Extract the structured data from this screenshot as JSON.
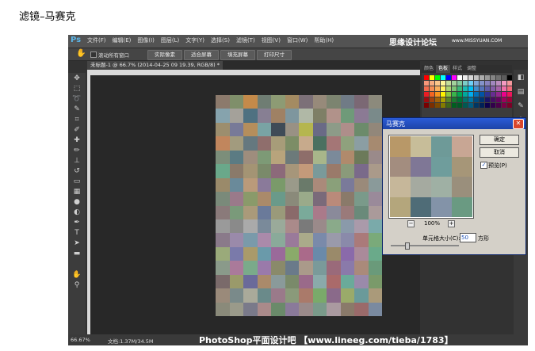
{
  "page_title": "滤镜–马赛克",
  "app": {
    "logo": "Ps",
    "menu": [
      "文件(F)",
      "编辑(E)",
      "图像(I)",
      "图层(L)",
      "文字(Y)",
      "选择(S)",
      "滤镜(T)",
      "视图(V)",
      "窗口(W)",
      "帮助(H)"
    ],
    "watermark_top": "思缘设计论坛",
    "watermark_top_url": "www.MISSYUAN.COM"
  },
  "options_bar": {
    "tool_icon": "hand-icon",
    "scroll_all_label": "滚动所有窗口",
    "buttons": [
      "实际像素",
      "适合屏幕",
      "填充屏幕",
      "打印尺寸"
    ]
  },
  "document": {
    "tab_label": "未标题-1 @ 66.7% (2014-04-25 09 19.39, RGB/8) *",
    "zoom": "66.67%",
    "doc_info": "文档:1.37M/34.5M"
  },
  "panel": {
    "tabs": [
      "颜色",
      "色板",
      "样式",
      "调整"
    ],
    "active_tab": "色板"
  },
  "dialog": {
    "title": "马赛克",
    "ok": "确定",
    "cancel": "取消",
    "preview_label": "预览(P)",
    "preview_checked": "✓",
    "zoom": "100%",
    "cell_size_label": "单元格大小(C):",
    "cell_size_value": "50",
    "cell_size_unit": "方形",
    "preview_cells": [
      "#b89868",
      "#c7bd99",
      "#6e9a98",
      "#c8a694",
      "#a38d7f",
      "#7f7796",
      "#6f9d9c",
      "#a69678",
      "#c6b79a",
      "#a5aaa0",
      "#9fb0a4",
      "#9a8f7c",
      "#b4a67c",
      "#4f6c77",
      "#8393a8",
      "#6a9a82"
    ]
  },
  "watermark_bottom": "PhotoShop平面设计吧 【www.lineeg.com/tieba/1783】",
  "mosaic_colors": [
    "#8c7a6c",
    "#7f8f6a",
    "#c48a4a",
    "#6f7d73",
    "#8d9b74",
    "#a48b62",
    "#7c7078",
    "#978a7a",
    "#7c8470",
    "#707b86",
    "#7b6874",
    "#8c8a7c",
    "#86a3ad",
    "#a4a19a",
    "#4f7181",
    "#877f93",
    "#9f8164",
    "#7e969e",
    "#b0b8a6",
    "#7e7f66",
    "#b1928a",
    "#6f9a79",
    "#8b7a94",
    "#7a8a8a",
    "#9c8e6e",
    "#787a98",
    "#b58e5c",
    "#79a3a4",
    "#3f4b57",
    "#999184",
    "#b5b64f",
    "#6a6a86",
    "#8d9b88",
    "#ae8e8a",
    "#6c8b6b",
    "#92877a",
    "#c1865d",
    "#a29b7e",
    "#65787f",
    "#8f6e6c",
    "#a79c79",
    "#7c8d66",
    "#c7aa8c",
    "#4b7060",
    "#a47676",
    "#8fa17d",
    "#8b9ea3",
    "#a68a70",
    "#7c8e7a",
    "#5b7b83",
    "#9e8d7d",
    "#7d9a76",
    "#b8a47c",
    "#6c7a7a",
    "#8e6e6a",
    "#a8b68a",
    "#7b8a9a",
    "#b08a6c",
    "#6c7a5a",
    "#9a8a8a",
    "#6aa88a",
    "#8a7a6a",
    "#a49474",
    "#7a8a6a",
    "#8c6a7a",
    "#a6967a",
    "#c49a7a",
    "#7a9a9a",
    "#9a7a6a",
    "#8a9a7a",
    "#7a6a8a",
    "#aa9a8a",
    "#9a8a6a",
    "#6a8a9a",
    "#ba9a7a",
    "#8a7a9a",
    "#7a9a6a",
    "#9a9a8a",
    "#6a7a6a",
    "#aa8a7a",
    "#8aa07a",
    "#7a7a9a",
    "#9a8a7a",
    "#8a9a9a",
    "#7a8a7a",
    "#9a7a8a",
    "#8a9a6a",
    "#aa8a6a",
    "#6a9a8a",
    "#8a8a7a",
    "#9aaa8a",
    "#7a6a7a",
    "#ba8a7a",
    "#8a7a6a",
    "#7a9a8a",
    "#9a8a9a",
    "#8a7a7a",
    "#7a9a7a",
    "#aa9a7a",
    "#6a7a9a",
    "#9a9a7a",
    "#8a6a6a",
    "#7aaa9a",
    "#aa7a8a",
    "#8a8a9a",
    "#9a7a7a",
    "#6a8a7a",
    "#aa9a9a",
    "#9a9a9a",
    "#8a8a8a",
    "#aaaaaa",
    "#7a8a9a",
    "#9aaa9a",
    "#aa8a8a",
    "#7a7a7a",
    "#9a8a8a",
    "#8aaa8a",
    "#8a9aaa",
    "#aa9aaa",
    "#7aaaaa",
    "#8a7a8a",
    "#9a8aaa",
    "#7a9aaa",
    "#aa8aaa",
    "#8aaa9a",
    "#9a7a9a",
    "#aaaa8a",
    "#7a8aaa",
    "#9a9aaa",
    "#8a8aaa",
    "#aa7a7a",
    "#7aaa7a",
    "#9aaa7a",
    "#7a7aaa",
    "#aa9a6a",
    "#6a9aaa",
    "#9a6a9a",
    "#8aaa6a",
    "#aa6a8a",
    "#6a8aaa",
    "#9a8a6a",
    "#8a6aaa",
    "#aa8a9a",
    "#6aaa8a",
    "#8a9a8a",
    "#aa7a9a",
    "#7aaa8a",
    "#9a7aaa",
    "#8a8a6a",
    "#6a7a8a",
    "#aa9a8a",
    "#7a9a9a",
    "#9a6a7a",
    "#8a7aaa",
    "#aa8a7a",
    "#6a9a7a",
    "#7a6a6a",
    "#9a9a6a",
    "#6a6a9a",
    "#aa8a6a",
    "#8a9a9a",
    "#7a8a6a",
    "#9a6a8a",
    "#8aaaaa",
    "#aa6a6a",
    "#6aaa9a",
    "#9a8aaa",
    "#7a9a6a",
    "#9a8a7a",
    "#7a8a8a",
    "#aaaa9a",
    "#6a8a8a",
    "#9a7a8a",
    "#8a9a7a",
    "#aa7a6a",
    "#7aaa6a",
    "#8a6a8a",
    "#9aaa6a",
    "#6a9a9a",
    "#aa9a7a",
    "#8a8a7a",
    "#9a9a8a",
    "#7a7a8a",
    "#aa8a8a",
    "#6a8a6a",
    "#8a7a9a",
    "#9a8a8a",
    "#7a9a8a",
    "#aa9aa0",
    "#8a7a6a",
    "#9a6a6a",
    "#7a8aa0"
  ],
  "swatch_colors": [
    "#ff0000",
    "#ffff00",
    "#00ff00",
    "#00ffff",
    "#0000ff",
    "#ff00ff",
    "#ffffff",
    "#ebebeb",
    "#d6d6d6",
    "#c2c2c2",
    "#adadad",
    "#999999",
    "#858585",
    "#707070",
    "#5c5c5c",
    "#000000",
    "#f7977a",
    "#f9ad81",
    "#fdc68a",
    "#fff79a",
    "#c4df9b",
    "#a3d39c",
    "#82ca9d",
    "#7bcdc8",
    "#6ecff6",
    "#7ea7d8",
    "#8493ca",
    "#8882be",
    "#a187be",
    "#bc8dbf",
    "#f49ac2",
    "#f6989d",
    "#f26c4f",
    "#f68e55",
    "#fbaf5c",
    "#fff467",
    "#acd372",
    "#7cc576",
    "#3bb878",
    "#1abbb4",
    "#00bff3",
    "#438ccb",
    "#5574b9",
    "#605ca8",
    "#855fa8",
    "#a763a8",
    "#f06ea9",
    "#f26d7d",
    "#ed1c24",
    "#f26522",
    "#f7941d",
    "#fff200",
    "#8dc73f",
    "#39b54a",
    "#00a651",
    "#00a99d",
    "#00aeef",
    "#0072bc",
    "#0054a6",
    "#2e3192",
    "#662d91",
    "#92278f",
    "#ec008c",
    "#ed145b",
    "#9e0b0f",
    "#a0410d",
    "#a36209",
    "#aba000",
    "#598527",
    "#1a7b30",
    "#007236",
    "#00746b",
    "#0076a3",
    "#004b80",
    "#003471",
    "#1b1464",
    "#440e62",
    "#630460",
    "#9e005d",
    "#9e0039",
    "#790000",
    "#7b2e00",
    "#7d4900",
    "#827b00",
    "#406618",
    "#005e20",
    "#005826",
    "#005952",
    "#005b7f",
    "#003663",
    "#002157",
    "#0d004c",
    "#32004b",
    "#4b0049",
    "#7b0046",
    "#7a0026"
  ]
}
